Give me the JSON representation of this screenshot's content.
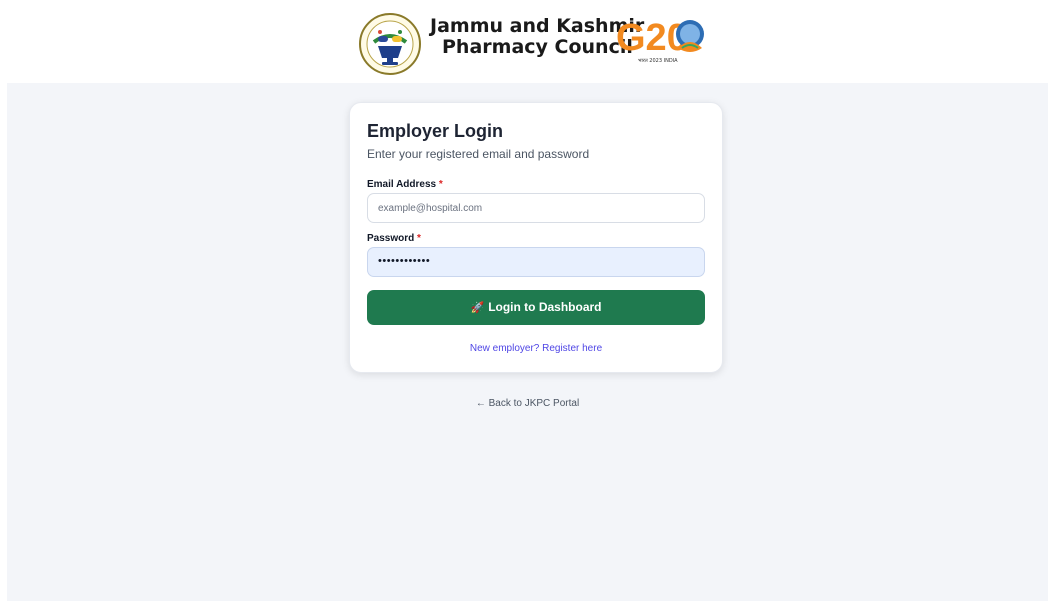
{
  "header": {
    "brand_line1": "Jammu and Kashmir",
    "brand_line2": "Pharmacy Council",
    "g20_mark": "G20",
    "g20_sub": "भारत 2023 INDIA",
    "logo_icon": "pharmacy-council-seal-icon",
    "colors": {
      "g20_orange": "#f28a20",
      "g20_green": "#3aa65b",
      "g20_blue": "#2d6db4"
    }
  },
  "login": {
    "title": "Employer Login",
    "subtitle": "Enter your registered email and password",
    "email": {
      "label": "Email Address",
      "required_mark": "*",
      "placeholder": "example@hospital.com",
      "value": ""
    },
    "password": {
      "label": "Password",
      "required_mark": "*",
      "value": "••••••••••••"
    },
    "submit": {
      "icon": "rocket-icon",
      "label": "Login to Dashboard"
    },
    "register_link": "New employer? Register here"
  },
  "footer": {
    "back_link": "← Back to JKPC Portal"
  },
  "colors": {
    "primary": "#1f7a4f",
    "link": "#4f46e5",
    "required": "#dc2626",
    "background": "#f3f5f9"
  }
}
